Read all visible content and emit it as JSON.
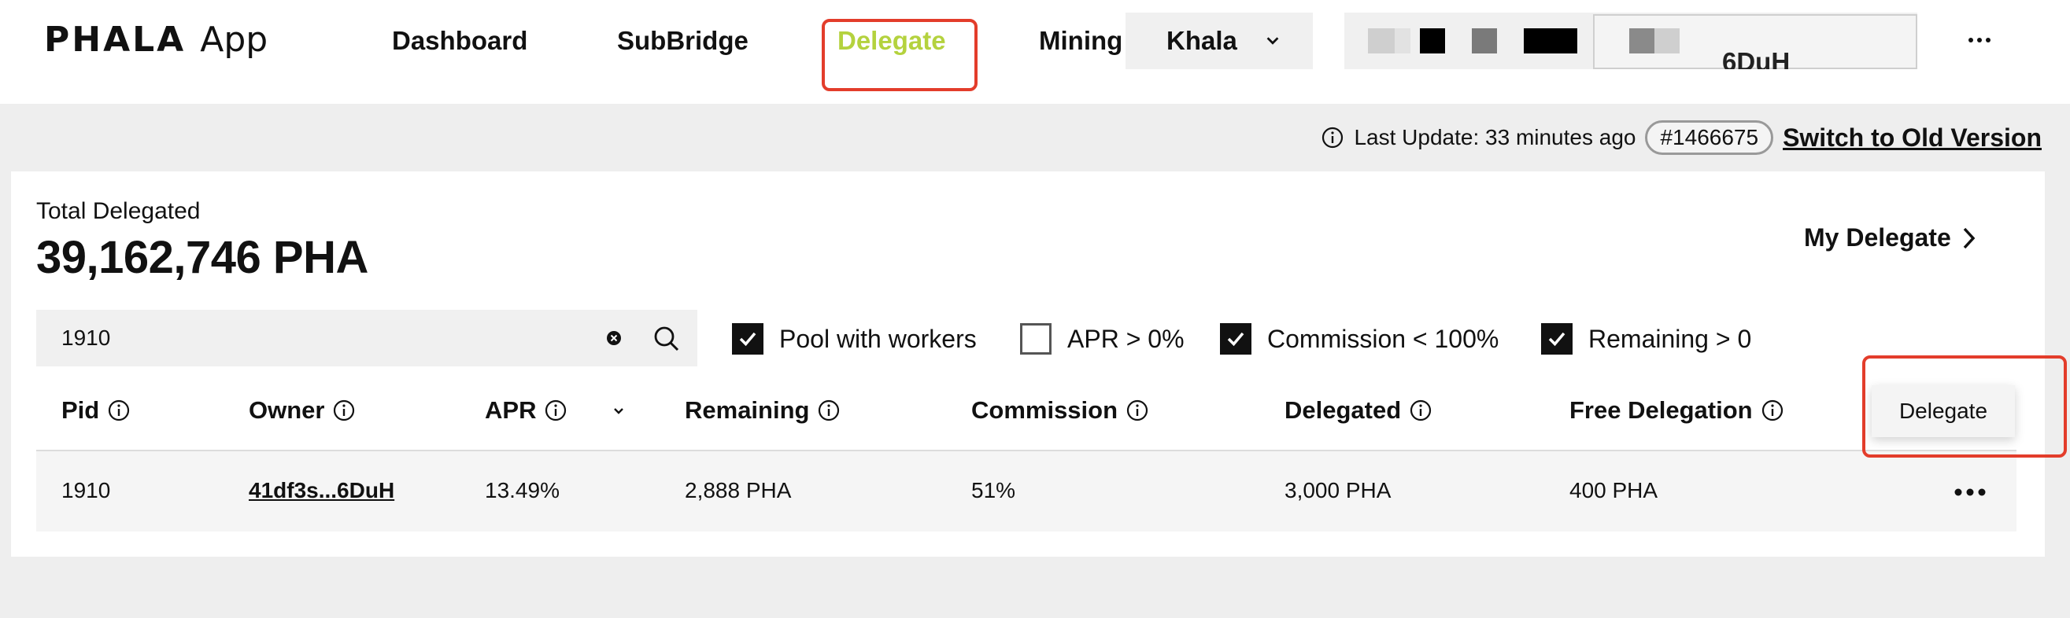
{
  "header": {
    "logo_mark": "PHALA",
    "logo_app": "App",
    "nav": [
      {
        "label": "Dashboard",
        "active": false
      },
      {
        "label": "SubBridge",
        "active": false
      },
      {
        "label": "Delegate",
        "active": true
      },
      {
        "label": "Mining",
        "active": false
      }
    ],
    "network": "Khala",
    "account_suffix": "6DuH"
  },
  "update_bar": {
    "text": "Last Update: 33 minutes ago",
    "block": "#1466675",
    "switch_link": "Switch to Old Version"
  },
  "summary": {
    "total_label": "Total Delegated",
    "total_value": "39,162,746 PHA",
    "my_delegate": "My Delegate"
  },
  "search": {
    "value": "1910"
  },
  "filters": [
    {
      "label": "Pool with workers",
      "checked": true
    },
    {
      "label": "APR > 0%",
      "checked": false
    },
    {
      "label": "Commission < 100%",
      "checked": true
    },
    {
      "label": "Remaining > 0",
      "checked": true
    }
  ],
  "table": {
    "columns": [
      "Pid",
      "Owner",
      "APR",
      "Remaining",
      "Commission",
      "Delegated",
      "Free Delegation"
    ],
    "rows": [
      {
        "pid": "1910",
        "owner": "41df3s...6DuH",
        "apr": "13.49%",
        "remaining": "2,888 PHA",
        "commission": "51%",
        "delegated": "3,000 PHA",
        "free_delegation": "400 PHA"
      }
    ]
  },
  "popup": {
    "action": "Delegate"
  },
  "colors": {
    "accent": "#b4d23e",
    "highlight": "#e33d2b",
    "background": "#eeeeee"
  }
}
